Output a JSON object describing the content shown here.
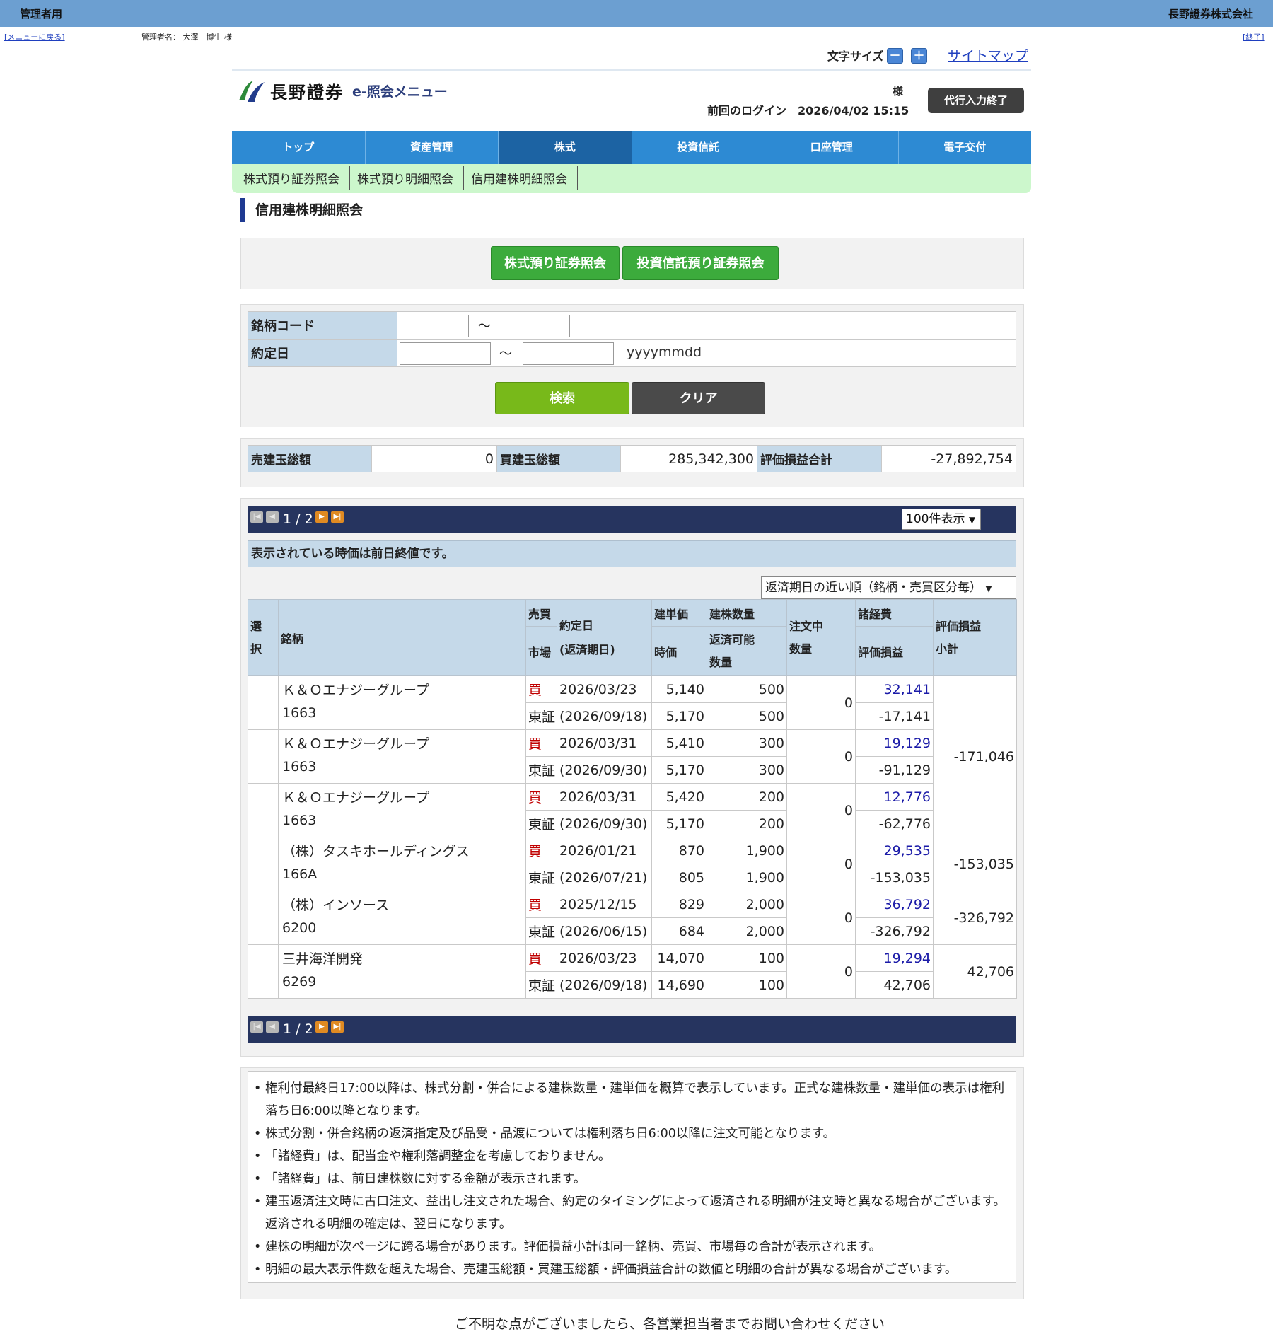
{
  "admin": {
    "label": "管理者用",
    "company": "長野證券株式会社",
    "back_link": "[メニューに戻る]",
    "admin_name": "管理者名： 大澤　博生 様",
    "end_link": "[終了]"
  },
  "header": {
    "font_size_label": "文字サイズ",
    "minus": "－",
    "plus": "＋",
    "sitemap": "サイトマップ",
    "logo_name": "長野證券",
    "logo_sub": "e-照会メニュー",
    "sama": "様",
    "last_login": "前回のログイン　2026/04/02 15:15",
    "proxy_end": "代行入力終了"
  },
  "nav": {
    "tabs": [
      "トップ",
      "資産管理",
      "株式",
      "投資信託",
      "口座管理",
      "電子交付"
    ],
    "active": "株式"
  },
  "subnav": [
    "株式預り証券照会",
    "株式預り明細照会",
    "信用建株明細照会"
  ],
  "page_title": "信用建株明細照会",
  "buttons": {
    "stock_custody": "株式預り証券照会",
    "fund_custody": "投資信託預り証券照会",
    "search": "検索",
    "clear": "クリア"
  },
  "form": {
    "code_label": "銘柄コード",
    "date_label": "約定日",
    "tilde": "～",
    "date_format": "yyyymmdd"
  },
  "totals": {
    "sell_label": "売建玉総額",
    "sell_value": "0",
    "buy_label": "買建玉総額",
    "buy_value": "285,342,300",
    "pl_label": "評価損益合計",
    "pl_value": "-27,892,754"
  },
  "pager": {
    "text": "1 / 2",
    "per_page": "100件表示",
    "notice": "表示されている時価は前日終値です。",
    "sort": "返済期日の近い順（銘柄・売買区分毎）"
  },
  "table": {
    "headers": {
      "select": "選\n択",
      "name": "銘柄",
      "side": "売買",
      "market": "市場",
      "trade_date": "約定日",
      "due_date": "(返済期日)",
      "open_price": "建単価",
      "price": "時価",
      "qty": "建株数量",
      "repay_qty": "返済可能\n数量",
      "order_qty": "注文中\n数量",
      "cost": "諸経費",
      "pl": "評価損益",
      "subtotal": "評価損益\n小計"
    },
    "rows": [
      {
        "name": "Ｋ＆Ｏエナジーグループ",
        "code": "1663",
        "side": "買",
        "market": "東証",
        "trade_date": "2026/03/23",
        "due_date": "(2026/09/18)",
        "open_price": "5,140",
        "price": "5,170",
        "qty": "500",
        "repay_qty": "500",
        "order_qty": "0",
        "cost": "32,141",
        "pl": "-17,141"
      },
      {
        "name": "Ｋ＆Ｏエナジーグループ",
        "code": "1663",
        "side": "買",
        "market": "東証",
        "trade_date": "2026/03/31",
        "due_date": "(2026/09/30)",
        "open_price": "5,410",
        "price": "5,170",
        "qty": "300",
        "repay_qty": "300",
        "order_qty": "0",
        "cost": "19,129",
        "pl": "-91,129"
      },
      {
        "name": "Ｋ＆Ｏエナジーグループ",
        "code": "1663",
        "side": "買",
        "market": "東証",
        "trade_date": "2026/03/31",
        "due_date": "(2026/09/30)",
        "open_price": "5,420",
        "price": "5,170",
        "qty": "200",
        "repay_qty": "200",
        "order_qty": "0",
        "cost": "12,776",
        "pl": "-62,776"
      },
      {
        "name": "（株）タスキホールディングス",
        "code": "166A",
        "side": "買",
        "market": "東証",
        "trade_date": "2026/01/21",
        "due_date": "(2026/07/21)",
        "open_price": "870",
        "price": "805",
        "qty": "1,900",
        "repay_qty": "1,900",
        "order_qty": "0",
        "cost": "29,535",
        "pl": "-153,035"
      },
      {
        "name": "（株）インソース",
        "code": "6200",
        "side": "買",
        "market": "東証",
        "trade_date": "2025/12/15",
        "due_date": "(2026/06/15)",
        "open_price": "829",
        "price": "684",
        "qty": "2,000",
        "repay_qty": "2,000",
        "order_qty": "0",
        "cost": "36,792",
        "pl": "-326,792"
      },
      {
        "name": "三井海洋開発",
        "code": "6269",
        "side": "買",
        "market": "東証",
        "trade_date": "2026/03/23",
        "due_date": "(2026/09/18)",
        "open_price": "14,070",
        "price": "14,690",
        "qty": "100",
        "repay_qty": "100",
        "order_qty": "0",
        "cost": "19,294",
        "pl": "42,706"
      }
    ],
    "subtotals": [
      "-171,046",
      "-153,035",
      "-326,792",
      "42,706"
    ]
  },
  "notes": [
    "権利付最終日17:00以降は、株式分割・併合による建株数量・建単価を概算で表示しています。正式な建株数量・建単価の表示は権利落ち日6:00以降となります。",
    "株式分割・併合銘柄の返済指定及び品受・品渡については権利落ち日6:00以降に注文可能となります。",
    "「諸経費」は、配当金や権利落調整金を考慮しておりません。",
    "「諸経費」は、前日建株数に対する金額が表示されます。",
    "建玉返済注文時に古口注文、益出し注文された場合、約定のタイミングによって返済される明細が注文時と異なる場合がございます。返済される明細の確定は、翌日になります。",
    "建株の明細が次ページに跨る場合があります。評価損益小計は同一銘柄、売買、市場毎の合計が表示されます。",
    "明細の最大表示件数を超えた場合、売建玉総額・買建玉総額・評価損益合計の数値と明細の合計が異なる場合がございます。"
  ],
  "footer": "ご不明な点がございましたら、各営業担当者までお問い合わせください"
}
